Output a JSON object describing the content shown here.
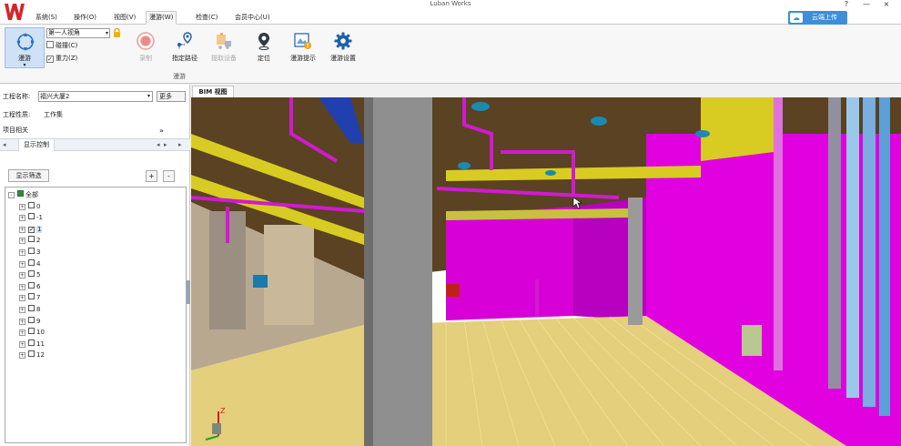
{
  "app": {
    "title": "Luban Works",
    "window_controls": {
      "help": "?",
      "minimize": "—",
      "close": "×"
    }
  },
  "menu": {
    "items": [
      {
        "label": "系统(S)"
      },
      {
        "label": "操作(O)"
      },
      {
        "label": "视图(V)"
      },
      {
        "label": "漫游(W)",
        "active": true
      },
      {
        "label": "检查(C)"
      },
      {
        "label": "会员中心(U)"
      }
    ],
    "cloud_upload_label": "云端上传"
  },
  "ribbon": {
    "roam_button_label": "漫游",
    "roam_dropdown_arrow": "▾",
    "view_mode": "第一人视角",
    "collision_label": "碰撞(C)",
    "gravity_label": "重力(Z)",
    "collision_checked": false,
    "gravity_checked": true,
    "buttons": [
      {
        "label": "录制",
        "icon": "record-icon",
        "disabled": true
      },
      {
        "label": "指定路径",
        "icon": "path-icon",
        "disabled": false
      },
      {
        "label": "提取设备",
        "icon": "extract-device-icon",
        "disabled": true
      },
      {
        "label": "定位",
        "icon": "locate-icon",
        "disabled": false
      },
      {
        "label": "漫游提示",
        "icon": "roam-tip-icon",
        "disabled": false
      },
      {
        "label": "漫游设置",
        "icon": "gear-icon",
        "disabled": false
      }
    ],
    "group_label": "漫游"
  },
  "left_panel": {
    "project_name_label": "工程名称:",
    "project_name_value": "福兴大厦2",
    "more_label": "更多",
    "project_type_label": "工程性质:",
    "project_type_value": "工作集",
    "project_related_label": "项目相关",
    "project_related_chevron": "»",
    "tab_label": "显示控制",
    "display_filter_label": "显示筛选",
    "add_label": "+",
    "remove_label": "-",
    "tree": [
      {
        "label": "全部",
        "level": 0,
        "expander": "-",
        "check": "partial"
      },
      {
        "label": "0",
        "level": 1,
        "expander": "+",
        "check": "none"
      },
      {
        "label": "-1",
        "level": 1,
        "expander": "+",
        "check": "none"
      },
      {
        "label": "1",
        "level": 1,
        "expander": "+",
        "check": "checked",
        "selected": true
      },
      {
        "label": "2",
        "level": 1,
        "expander": "+",
        "check": "none"
      },
      {
        "label": "3",
        "level": 1,
        "expander": "+",
        "check": "none"
      },
      {
        "label": "4",
        "level": 1,
        "expander": "+",
        "check": "none"
      },
      {
        "label": "5",
        "level": 1,
        "expander": "+",
        "check": "none"
      },
      {
        "label": "6",
        "level": 1,
        "expander": "+",
        "check": "none"
      },
      {
        "label": "7",
        "level": 1,
        "expander": "+",
        "check": "none"
      },
      {
        "label": "8",
        "level": 1,
        "expander": "+",
        "check": "none"
      },
      {
        "label": "9",
        "level": 1,
        "expander": "+",
        "check": "none"
      },
      {
        "label": "10",
        "level": 1,
        "expander": "+",
        "check": "none"
      },
      {
        "label": "11",
        "level": 1,
        "expander": "+",
        "check": "none"
      },
      {
        "label": "12",
        "level": 1,
        "expander": "+",
        "check": "none"
      }
    ]
  },
  "viewport": {
    "tab_label": "BIM 视图",
    "axis_label": "Z"
  },
  "colors": {
    "brand_red": "#d3262b",
    "accent_blue": "#3c8fd8",
    "wall_magenta": "#e600e6",
    "floor_yellow": "#e4cf7c",
    "ceiling_brown": "#5e4422",
    "column_gray": "#8f8f8f"
  }
}
